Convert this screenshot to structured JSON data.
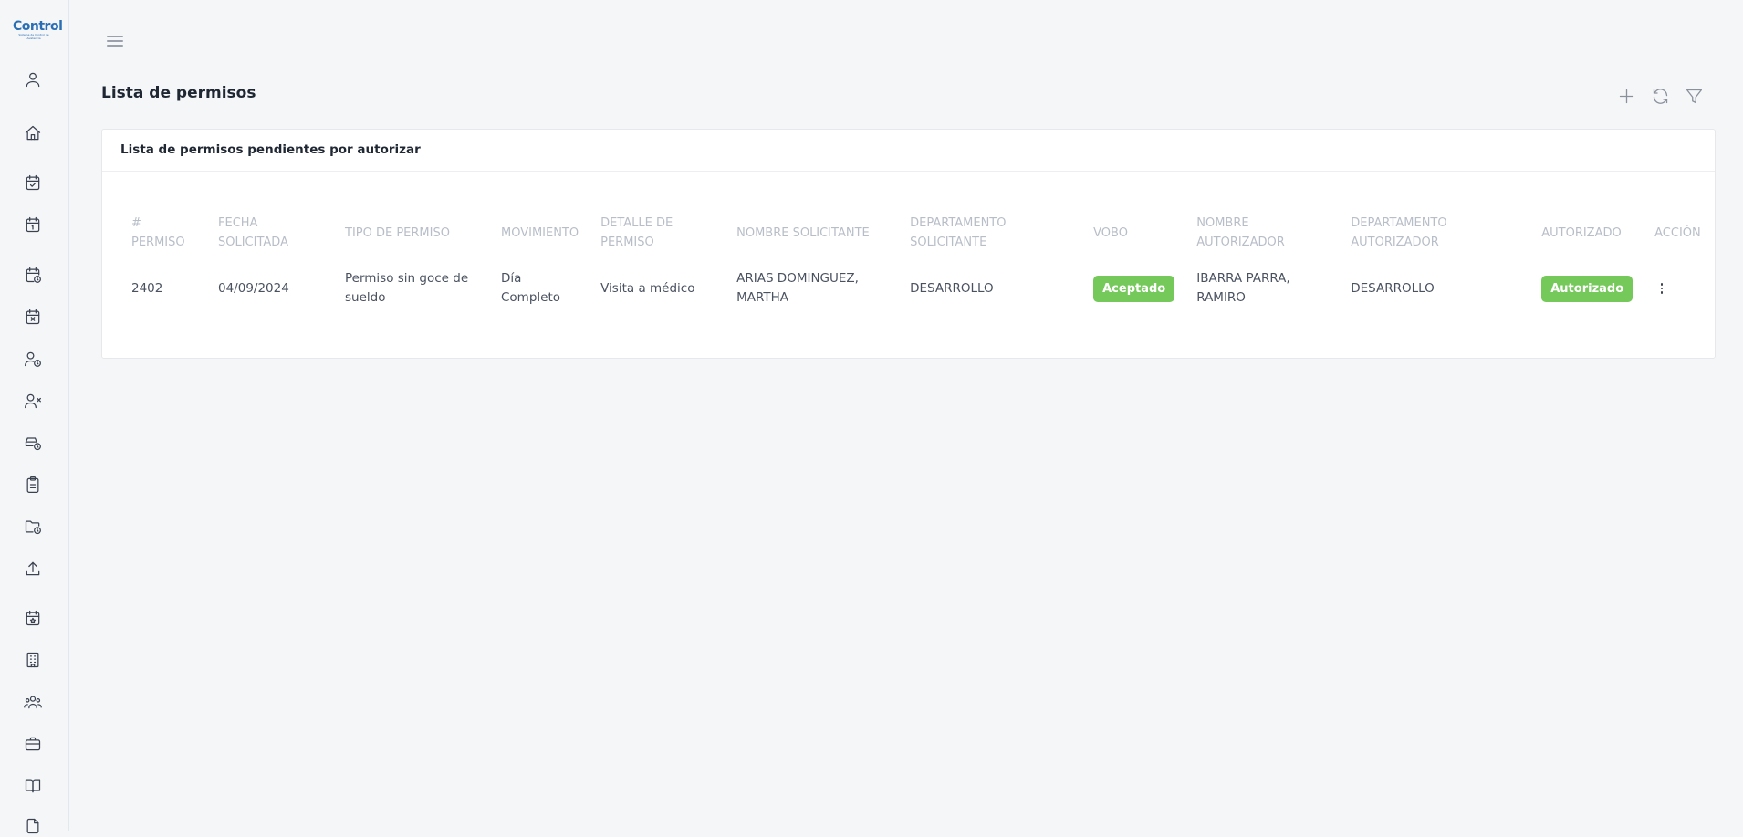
{
  "app": {
    "logo_text": "Control",
    "logo_sub": "Sistema de Control de Asistencia"
  },
  "sidebar": {
    "items": [
      {
        "icon": "user-icon"
      },
      {
        "icon": "home-icon"
      },
      {
        "icon": "calendar-check-icon"
      },
      {
        "icon": "calendar-one-icon"
      },
      {
        "icon": "calendar-clock-icon"
      },
      {
        "icon": "calendar-x-icon"
      },
      {
        "icon": "user-clock-icon"
      },
      {
        "icon": "user-x-icon"
      },
      {
        "icon": "car-clock-icon"
      },
      {
        "icon": "clipboard-icon"
      },
      {
        "icon": "folder-clock-icon"
      },
      {
        "icon": "upload-icon"
      },
      {
        "icon": "calendar-star-icon"
      },
      {
        "icon": "building-icon"
      },
      {
        "icon": "users-icon"
      },
      {
        "icon": "briefcase-icon"
      },
      {
        "icon": "book-icon"
      },
      {
        "icon": "file-icon"
      }
    ]
  },
  "header": {
    "title": "Lista de permisos"
  },
  "toolbar": {
    "add_icon": "plus-icon",
    "refresh_icon": "refresh-icon",
    "filter_icon": "filter-icon"
  },
  "card": {
    "title": "Lista de permisos pendientes por autorizar",
    "columns": [
      "# permiso",
      "Fecha solicitada",
      "Tipo de permiso",
      "Movimiento",
      "Detalle de permiso",
      "Nombre solicitante",
      "Departamento solicitante",
      "VoBo",
      "Nombre autorizador",
      "Departamento autorizador",
      "Autorizado",
      "Acción"
    ],
    "rows": [
      {
        "permiso": "2402",
        "fecha": "04/09/2024",
        "tipo": "Permiso sin goce de sueldo",
        "movimiento": "Día Completo",
        "detalle": "Visita a médico",
        "solicitante": "ARIAS DOMINGUEZ, MARTHA",
        "depto_solicitante": "DESARROLLO",
        "vobo": "Aceptado",
        "autorizador": "IBARRA PARRA, RAMIRO",
        "depto_autorizador": "DESARROLLO",
        "autorizado": "Autorizado"
      }
    ]
  },
  "colors": {
    "accent_green": "#74c95a",
    "brand_blue": "#2a6fb5"
  }
}
